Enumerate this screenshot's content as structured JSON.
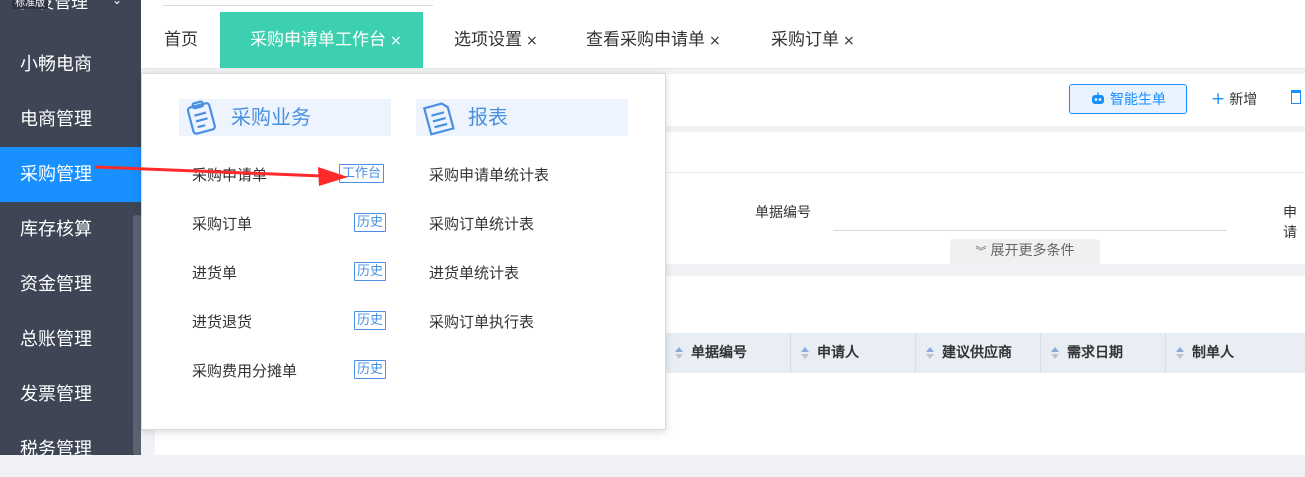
{
  "sidebar": {
    "partial_top_label": "批发管理",
    "partial_badge": "标准版",
    "items": [
      {
        "label": "小畅电商"
      },
      {
        "label": "电商管理"
      },
      {
        "label": "采购管理"
      },
      {
        "label": "库存核算"
      },
      {
        "label": "资金管理"
      },
      {
        "label": "总账管理"
      },
      {
        "label": "发票管理"
      },
      {
        "label": "税务管理"
      }
    ],
    "active_index": 2
  },
  "tabs": [
    {
      "label": "首页"
    },
    {
      "label": "采购申请单工作台",
      "close": "×"
    },
    {
      "label": "选项设置",
      "close": "×"
    },
    {
      "label": "查看采购申请单",
      "close": "×"
    },
    {
      "label": "采购订单",
      "close": "×"
    }
  ],
  "toolbar": {
    "smart_label": "智能生单",
    "add_label": "新增",
    "add_symbol": "+"
  },
  "filter": {
    "doc_no_label": "单据编号",
    "doc_no_value": "",
    "request_label_partial": "申请",
    "expand_label": "展开更多条件",
    "expand_icon": "»"
  },
  "table": {
    "columns": [
      "单据编号",
      "申请人",
      "建议供应商",
      "需求日期",
      "制单人"
    ]
  },
  "menu": {
    "purchase": {
      "title": "采购业务",
      "items": [
        {
          "label": "采购申请单",
          "tag": "工作台"
        },
        {
          "label": "采购订单",
          "tag": "历史"
        },
        {
          "label": "进货单",
          "tag": "历史"
        },
        {
          "label": "进货退货",
          "tag": "历史"
        },
        {
          "label": "采购费用分摊单",
          "tag": "历史"
        }
      ]
    },
    "report": {
      "title": "报表",
      "items": [
        {
          "label": "采购申请单统计表"
        },
        {
          "label": "采购订单统计表"
        },
        {
          "label": "进货单统计表"
        },
        {
          "label": "采购订单执行表"
        }
      ]
    }
  },
  "colors": {
    "sidebar_bg": "#3e4656",
    "sidebar_active": "#1890ff",
    "tab_active": "#3cd0b0",
    "accent": "#4a90e2",
    "arrow": "#ff2a2a"
  },
  "icons": {
    "smart": "robot-icon",
    "add": "plus-icon",
    "delete": "trash-icon",
    "purchase": "clipboard-icon",
    "report": "report-icon"
  }
}
